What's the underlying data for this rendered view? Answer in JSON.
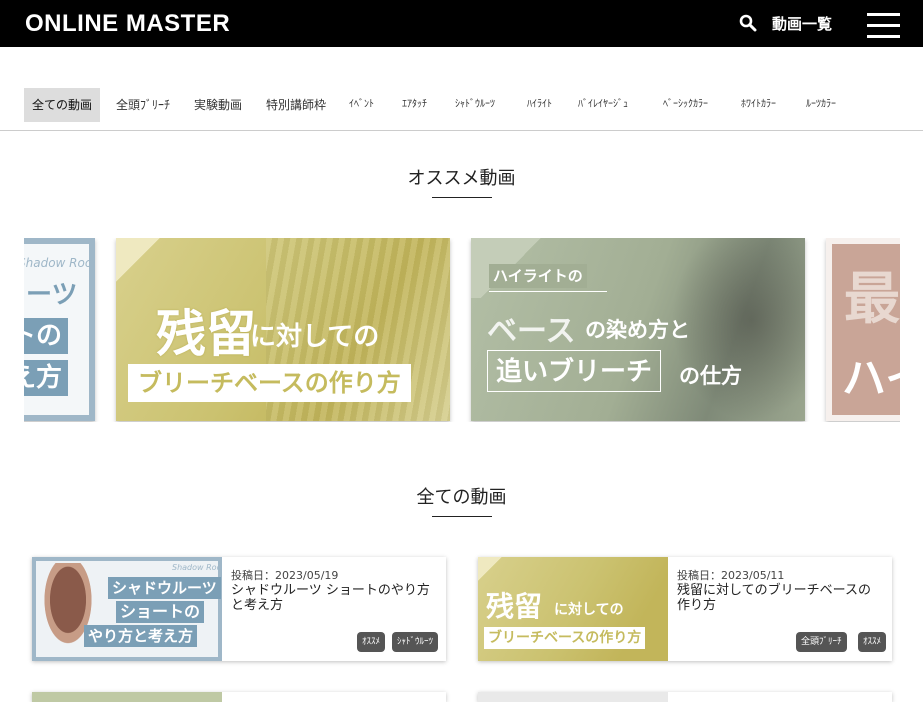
{
  "header": {
    "logo": "ONLINE MASTER",
    "nav_label": "動画一覧",
    "icons": [
      "search-icon",
      "menu-icon"
    ]
  },
  "categories": [
    {
      "label": "全ての動画",
      "active": true
    },
    {
      "label": "全頭ﾌﾞﾘｰﾁ"
    },
    {
      "label": "実験動画"
    },
    {
      "label": "特別講師枠"
    },
    {
      "label": "ｲﾍﾞﾝﾄ"
    },
    {
      "label": "ｴｱﾀｯﾁ"
    },
    {
      "label": "ｼｬﾄﾞｳﾙｰﾂ"
    },
    {
      "label": "ﾊｲﾗｲﾄ"
    },
    {
      "label": "ﾊﾞｲﾚｲﾔｰｼﾞｭ"
    },
    {
      "label": "ﾍﾞｰｼｯｸｶﾗｰ"
    },
    {
      "label": "ﾎﾜｲﾄｶﾗｰ"
    },
    {
      "label": "ﾙｰﾂｶﾗｰ"
    }
  ],
  "recommended": {
    "title": "オススメ動画",
    "slides": [
      {
        "line1": "Shadow Roots",
        "line2": "ーツ",
        "line3": "トの",
        "line4": "え方"
      },
      {
        "big": "残留",
        "line1": "に対しての",
        "line2": "ブリーチベースの作り方"
      },
      {
        "line0": "ハイライトの",
        "line1": "ベース",
        "line1b": "の染め方と",
        "line2": "追いブリーチ",
        "line2b": "の仕方"
      },
      {
        "line1": "最",
        "line2": "ハイ"
      }
    ]
  },
  "all_videos": {
    "title": "全ての動画",
    "cards": [
      {
        "date": "投稿日：2023/05/19",
        "title": "シャドウルーツ ショートのやり方と考え方",
        "thumb": {
          "tag": "Shadow Roots",
          "line1": "シャドウルーツ",
          "line2": "ショートの",
          "line3": "やり方と考え方"
        },
        "tags": [
          "ｵｽｽﾒ",
          "ｼｬﾄﾞｳﾙｰﾂ"
        ]
      },
      {
        "date": "投稿日：2023/05/11",
        "title": "残留に対してのブリーチベースの作り方",
        "thumb": {
          "big": "残留",
          "line1": "に対しての",
          "line2": "ブリーチベースの作り方"
        },
        "tags": [
          "全頭ﾌﾞﾘｰﾁ",
          "ｵｽｽﾒ"
        ]
      }
    ]
  },
  "colors": {
    "header_bg": "#000000",
    "tag_bg": "#555555",
    "yellow": "#cfc677",
    "sage": "#a7b49a",
    "blue": "#9fb7c8",
    "pink": "#c9a597"
  }
}
